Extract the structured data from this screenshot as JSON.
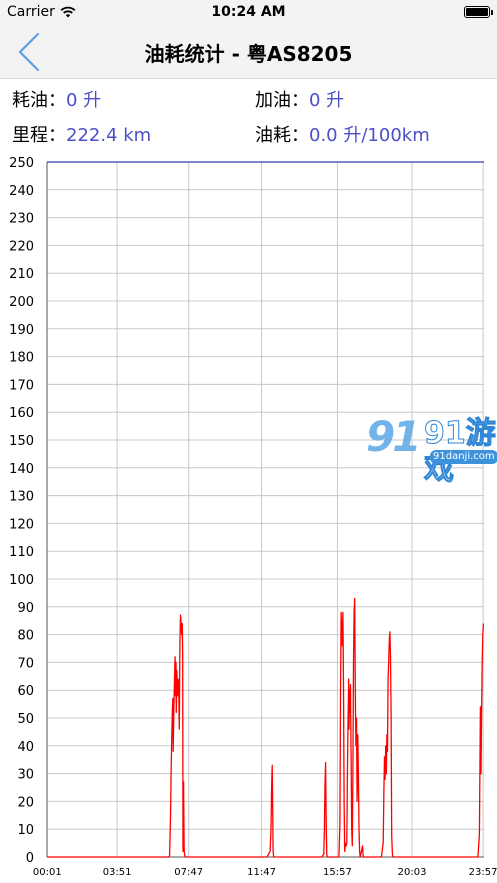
{
  "status_bar": {
    "carrier": "Carrier",
    "time": "10:24 AM"
  },
  "nav": {
    "title": "油耗统计 - 粤AS8205",
    "back_icon": "chevron-left-icon"
  },
  "stats": [
    {
      "label": "耗油：",
      "value": "0 升"
    },
    {
      "label": "加油：",
      "value": "0 升"
    },
    {
      "label": "里程：",
      "value": "222.4 km"
    },
    {
      "label": "油耗：",
      "value": "0.0 升/100km"
    }
  ],
  "watermark": {
    "text": "91游戏",
    "url": "91danji.com"
  },
  "colors": {
    "accent": "#4b4fc8",
    "line": "#ff0000",
    "grid": "#c8c8c8"
  },
  "chart_data": {
    "type": "line",
    "xlabel": "",
    "ylabel": "",
    "ylim": [
      0,
      250
    ],
    "ytick_step": 10,
    "grid": true,
    "x_tick_labels": [
      "00:01",
      "03:51",
      "07:47",
      "11:47",
      "15:57",
      "20:03",
      "23:57"
    ],
    "x_tick_minutes": [
      1,
      231,
      467,
      707,
      957,
      1203,
      1437
    ],
    "x_range_minutes": [
      0,
      1440
    ],
    "series": [
      {
        "color": "#ff0000",
        "points": [
          [
            0,
            0
          ],
          [
            395,
            0
          ],
          [
            400,
            0
          ],
          [
            404,
            0.5
          ],
          [
            407,
            14
          ],
          [
            409,
            30
          ],
          [
            411,
            42
          ],
          [
            413,
            52
          ],
          [
            415,
            57
          ],
          [
            416,
            38
          ],
          [
            418,
            54
          ],
          [
            420,
            64
          ],
          [
            422,
            72
          ],
          [
            423,
            58
          ],
          [
            425,
            70
          ],
          [
            426,
            52
          ],
          [
            428,
            67
          ],
          [
            430,
            58
          ],
          [
            432,
            64
          ],
          [
            434,
            63
          ],
          [
            436,
            46
          ],
          [
            438,
            76
          ],
          [
            440,
            87
          ],
          [
            442,
            84
          ],
          [
            444,
            80
          ],
          [
            446,
            84
          ],
          [
            447,
            72
          ],
          [
            448,
            2
          ],
          [
            449,
            18
          ],
          [
            450,
            27
          ],
          [
            451,
            12
          ],
          [
            452,
            2
          ],
          [
            455,
            0
          ],
          [
            480,
            0
          ],
          [
            700,
            0
          ],
          [
            725,
            0
          ],
          [
            735,
            2
          ],
          [
            738,
            10
          ],
          [
            740,
            25
          ],
          [
            742,
            33
          ],
          [
            744,
            14
          ],
          [
            745,
            2
          ],
          [
            747,
            0
          ],
          [
            905,
            0
          ],
          [
            912,
            1
          ],
          [
            914,
            10
          ],
          [
            916,
            26
          ],
          [
            918,
            34
          ],
          [
            920,
            12
          ],
          [
            922,
            1
          ],
          [
            924,
            0
          ],
          [
            962,
            0
          ],
          [
            965,
            12
          ],
          [
            967,
            56
          ],
          [
            969,
            88
          ],
          [
            971,
            82
          ],
          [
            973,
            76
          ],
          [
            975,
            88
          ],
          [
            977,
            62
          ],
          [
            979,
            20
          ],
          [
            981,
            2
          ],
          [
            983,
            5
          ],
          [
            986,
            4
          ],
          [
            988,
            5
          ],
          [
            990,
            30
          ],
          [
            992,
            48
          ],
          [
            994,
            64
          ],
          [
            995,
            46
          ],
          [
            997,
            60
          ],
          [
            998,
            52
          ],
          [
            1000,
            62
          ],
          [
            1002,
            36
          ],
          [
            1004,
            10
          ],
          [
            1006,
            4
          ],
          [
            1008,
            30
          ],
          [
            1010,
            70
          ],
          [
            1012,
            88
          ],
          [
            1014,
            93
          ],
          [
            1016,
            60
          ],
          [
            1018,
            40
          ],
          [
            1020,
            50
          ],
          [
            1022,
            20
          ],
          [
            1024,
            44
          ],
          [
            1026,
            30
          ],
          [
            1028,
            10
          ],
          [
            1030,
            2
          ],
          [
            1032,
            0
          ],
          [
            1040,
            4
          ],
          [
            1042,
            0
          ],
          [
            1055,
            0
          ],
          [
            1102,
            0
          ],
          [
            1108,
            5
          ],
          [
            1110,
            24
          ],
          [
            1112,
            36
          ],
          [
            1114,
            28
          ],
          [
            1116,
            40
          ],
          [
            1118,
            30
          ],
          [
            1120,
            44
          ],
          [
            1122,
            38
          ],
          [
            1124,
            64
          ],
          [
            1126,
            70
          ],
          [
            1128,
            78
          ],
          [
            1130,
            81
          ],
          [
            1132,
            72
          ],
          [
            1134,
            52
          ],
          [
            1136,
            8
          ],
          [
            1138,
            1
          ],
          [
            1140,
            0
          ],
          [
            1420,
            0
          ],
          [
            1425,
            8
          ],
          [
            1427,
            40
          ],
          [
            1428,
            54
          ],
          [
            1430,
            30
          ],
          [
            1432,
            52
          ],
          [
            1434,
            70
          ],
          [
            1436,
            80
          ],
          [
            1438,
            84
          ]
        ]
      }
    ]
  }
}
